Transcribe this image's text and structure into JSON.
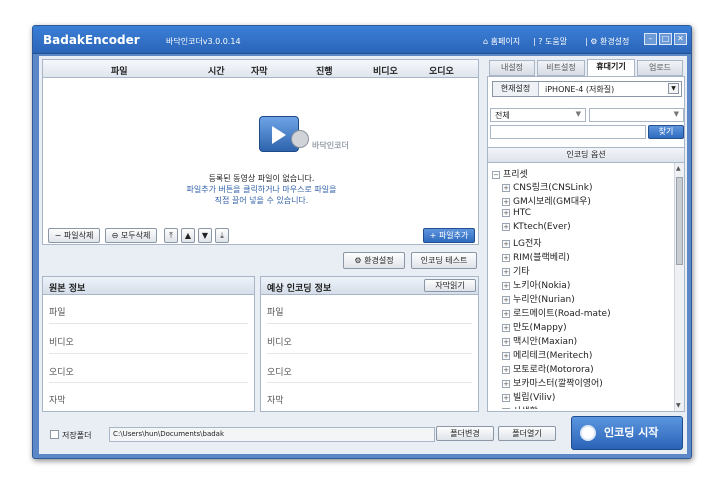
{
  "title": {
    "app": "BadakEncoder",
    "version": "바닥인코더v3.0.0.14",
    "homepage": "홈페이지",
    "help": "도움말",
    "settings": "환경설정"
  },
  "file_list": {
    "columns": [
      "파일",
      "시간",
      "자막",
      "진행",
      "비디오",
      "오디오"
    ],
    "logo_caption": "바닥인코더",
    "empty_line1": "등록된 동영상 파일이 없습니다.",
    "empty_line2": "파일추가 버튼을 클릭하거나 마우스로 파일을",
    "empty_line3": "직접 끌어 넣을 수 있습니다.",
    "remove_file": "파일삭제",
    "remove_all": "모두삭제",
    "add_file": "파일추가"
  },
  "toolbar": {
    "env_settings": "환경설정",
    "encode_test": "인코딩 테스트"
  },
  "source_info": {
    "title": "원본 정보",
    "rows": [
      "파일",
      "비디오",
      "오디오",
      "자막"
    ]
  },
  "expected_info": {
    "title": "예상 인코딩 정보",
    "subtitle_btn": "자막읽기",
    "rows": [
      "파일",
      "비디오",
      "오디오",
      "자막"
    ]
  },
  "save": {
    "label": "저장폴더",
    "path": "C:\\Users\\hun\\Documents\\badak",
    "change_btn": "폴더변경",
    "open_btn": "폴더열기"
  },
  "start_btn": "인코딩 시작",
  "right_panel": {
    "tabs": [
      "내설정",
      "비트설정",
      "휴대기기",
      "업로드"
    ],
    "active_tab": "휴대기기",
    "current_label": "현재설정",
    "current_value": "iPHONE-4 (저화질)",
    "filter1": "전체",
    "search_btn": "찾기",
    "options_title": "인코딩 옵션",
    "tree_root": "프리셋",
    "tree_items": [
      "CNS링크(CNSLink)",
      "GM시보레(GM대우)",
      "HTC",
      "KTtech(Ever)",
      "LG전자",
      "RIM(블랙베리)",
      "기타",
      "노키아(Nokia)",
      "누리안(Nurian)",
      "로드메이트(Road-mate)",
      "만도(Mappy)",
      "맥시안(Maxian)",
      "메리테크(Meritech)",
      "모토로라(Motorora)",
      "보카마스터(깔짝이영어)",
      "빌립(Viliv)",
      "사생활"
    ]
  },
  "colors": {
    "titlebar": "#2f6dc4",
    "accent": "#2f6bbf"
  }
}
